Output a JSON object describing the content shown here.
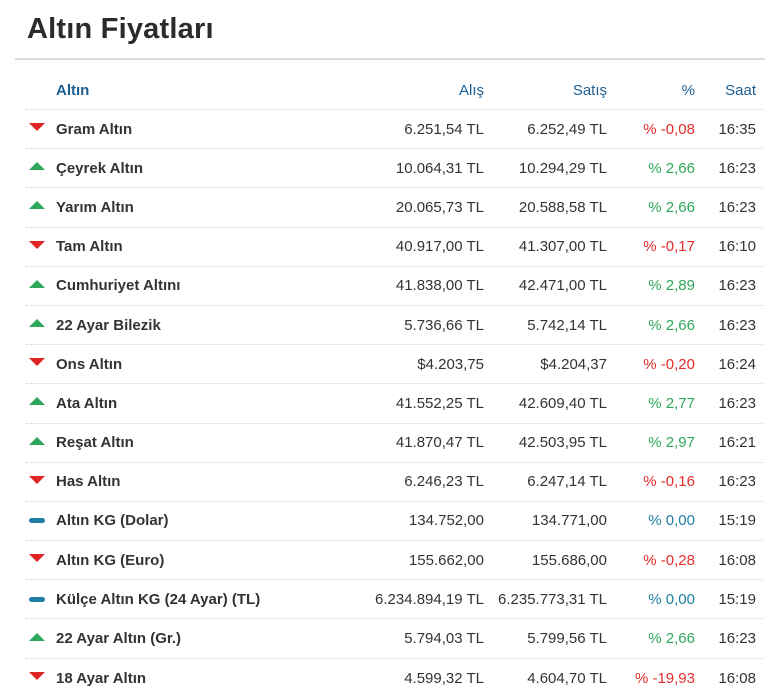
{
  "page": {
    "title": "Altın Fiyatları"
  },
  "colors": {
    "up": "#2ea85a",
    "down": "#e02424",
    "flat": "#1e7fa3",
    "header": "#1d5f93"
  },
  "table": {
    "headers": {
      "name": "Altın",
      "alis": "Alış",
      "satis": "Satış",
      "pct": "%",
      "saat": "Saat"
    },
    "rows": [
      {
        "trend": "down",
        "icon": "down-arrow-icon",
        "name": "Gram Altın",
        "alis": "6.251,54 TL",
        "satis": "6.252,49 TL",
        "pct": "% -0,08",
        "saat": "16:35"
      },
      {
        "trend": "up",
        "icon": "up-arrow-icon",
        "name": "Çeyrek Altın",
        "alis": "10.064,31 TL",
        "satis": "10.294,29 TL",
        "pct": "% 2,66",
        "saat": "16:23"
      },
      {
        "trend": "up",
        "icon": "up-arrow-icon",
        "name": "Yarım Altın",
        "alis": "20.065,73 TL",
        "satis": "20.588,58 TL",
        "pct": "% 2,66",
        "saat": "16:23"
      },
      {
        "trend": "down",
        "icon": "down-arrow-icon",
        "name": "Tam Altın",
        "alis": "40.917,00 TL",
        "satis": "41.307,00 TL",
        "pct": "% -0,17",
        "saat": "16:10"
      },
      {
        "trend": "up",
        "icon": "up-arrow-icon",
        "name": "Cumhuriyet Altını",
        "alis": "41.838,00 TL",
        "satis": "42.471,00 TL",
        "pct": "% 2,89",
        "saat": "16:23"
      },
      {
        "trend": "up",
        "icon": "up-arrow-icon",
        "name": "22 Ayar Bilezik",
        "alis": "5.736,66 TL",
        "satis": "5.742,14 TL",
        "pct": "% 2,66",
        "saat": "16:23"
      },
      {
        "trend": "down",
        "icon": "down-arrow-icon",
        "name": "Ons Altın",
        "alis": "$4.203,75",
        "satis": "$4.204,37",
        "pct": "% -0,20",
        "saat": "16:24"
      },
      {
        "trend": "up",
        "icon": "up-arrow-icon",
        "name": "Ata Altın",
        "alis": "41.552,25 TL",
        "satis": "42.609,40 TL",
        "pct": "% 2,77",
        "saat": "16:23"
      },
      {
        "trend": "up",
        "icon": "up-arrow-icon",
        "name": "Reşat Altın",
        "alis": "41.870,47 TL",
        "satis": "42.503,95 TL",
        "pct": "% 2,97",
        "saat": "16:21"
      },
      {
        "trend": "down",
        "icon": "down-arrow-icon",
        "name": "Has Altın",
        "alis": "6.246,23 TL",
        "satis": "6.247,14 TL",
        "pct": "% -0,16",
        "saat": "16:23"
      },
      {
        "trend": "flat",
        "icon": "dash-icon",
        "name": "Altın KG (Dolar)",
        "alis": "134.752,00",
        "satis": "134.771,00",
        "pct": "% 0,00",
        "saat": "15:19"
      },
      {
        "trend": "down",
        "icon": "down-arrow-icon",
        "name": "Altın KG (Euro)",
        "alis": "155.662,00",
        "satis": "155.686,00",
        "pct": "% -0,28",
        "saat": "16:08"
      },
      {
        "trend": "flat",
        "icon": "dash-icon",
        "name": "Külçe Altın KG (24 Ayar) (TL)",
        "alis": "6.234.894,19 TL",
        "satis": "6.235.773,31 TL",
        "pct": "% 0,00",
        "saat": "15:19"
      },
      {
        "trend": "up",
        "icon": "up-arrow-icon",
        "name": "22 Ayar Altın (Gr.)",
        "alis": "5.794,03 TL",
        "satis": "5.799,56 TL",
        "pct": "% 2,66",
        "saat": "16:23"
      },
      {
        "trend": "down",
        "icon": "down-arrow-icon",
        "name": "18 Ayar Altın",
        "alis": "4.599,32 TL",
        "satis": "4.604,70 TL",
        "pct": "% -19,93",
        "saat": "16:08"
      }
    ]
  }
}
